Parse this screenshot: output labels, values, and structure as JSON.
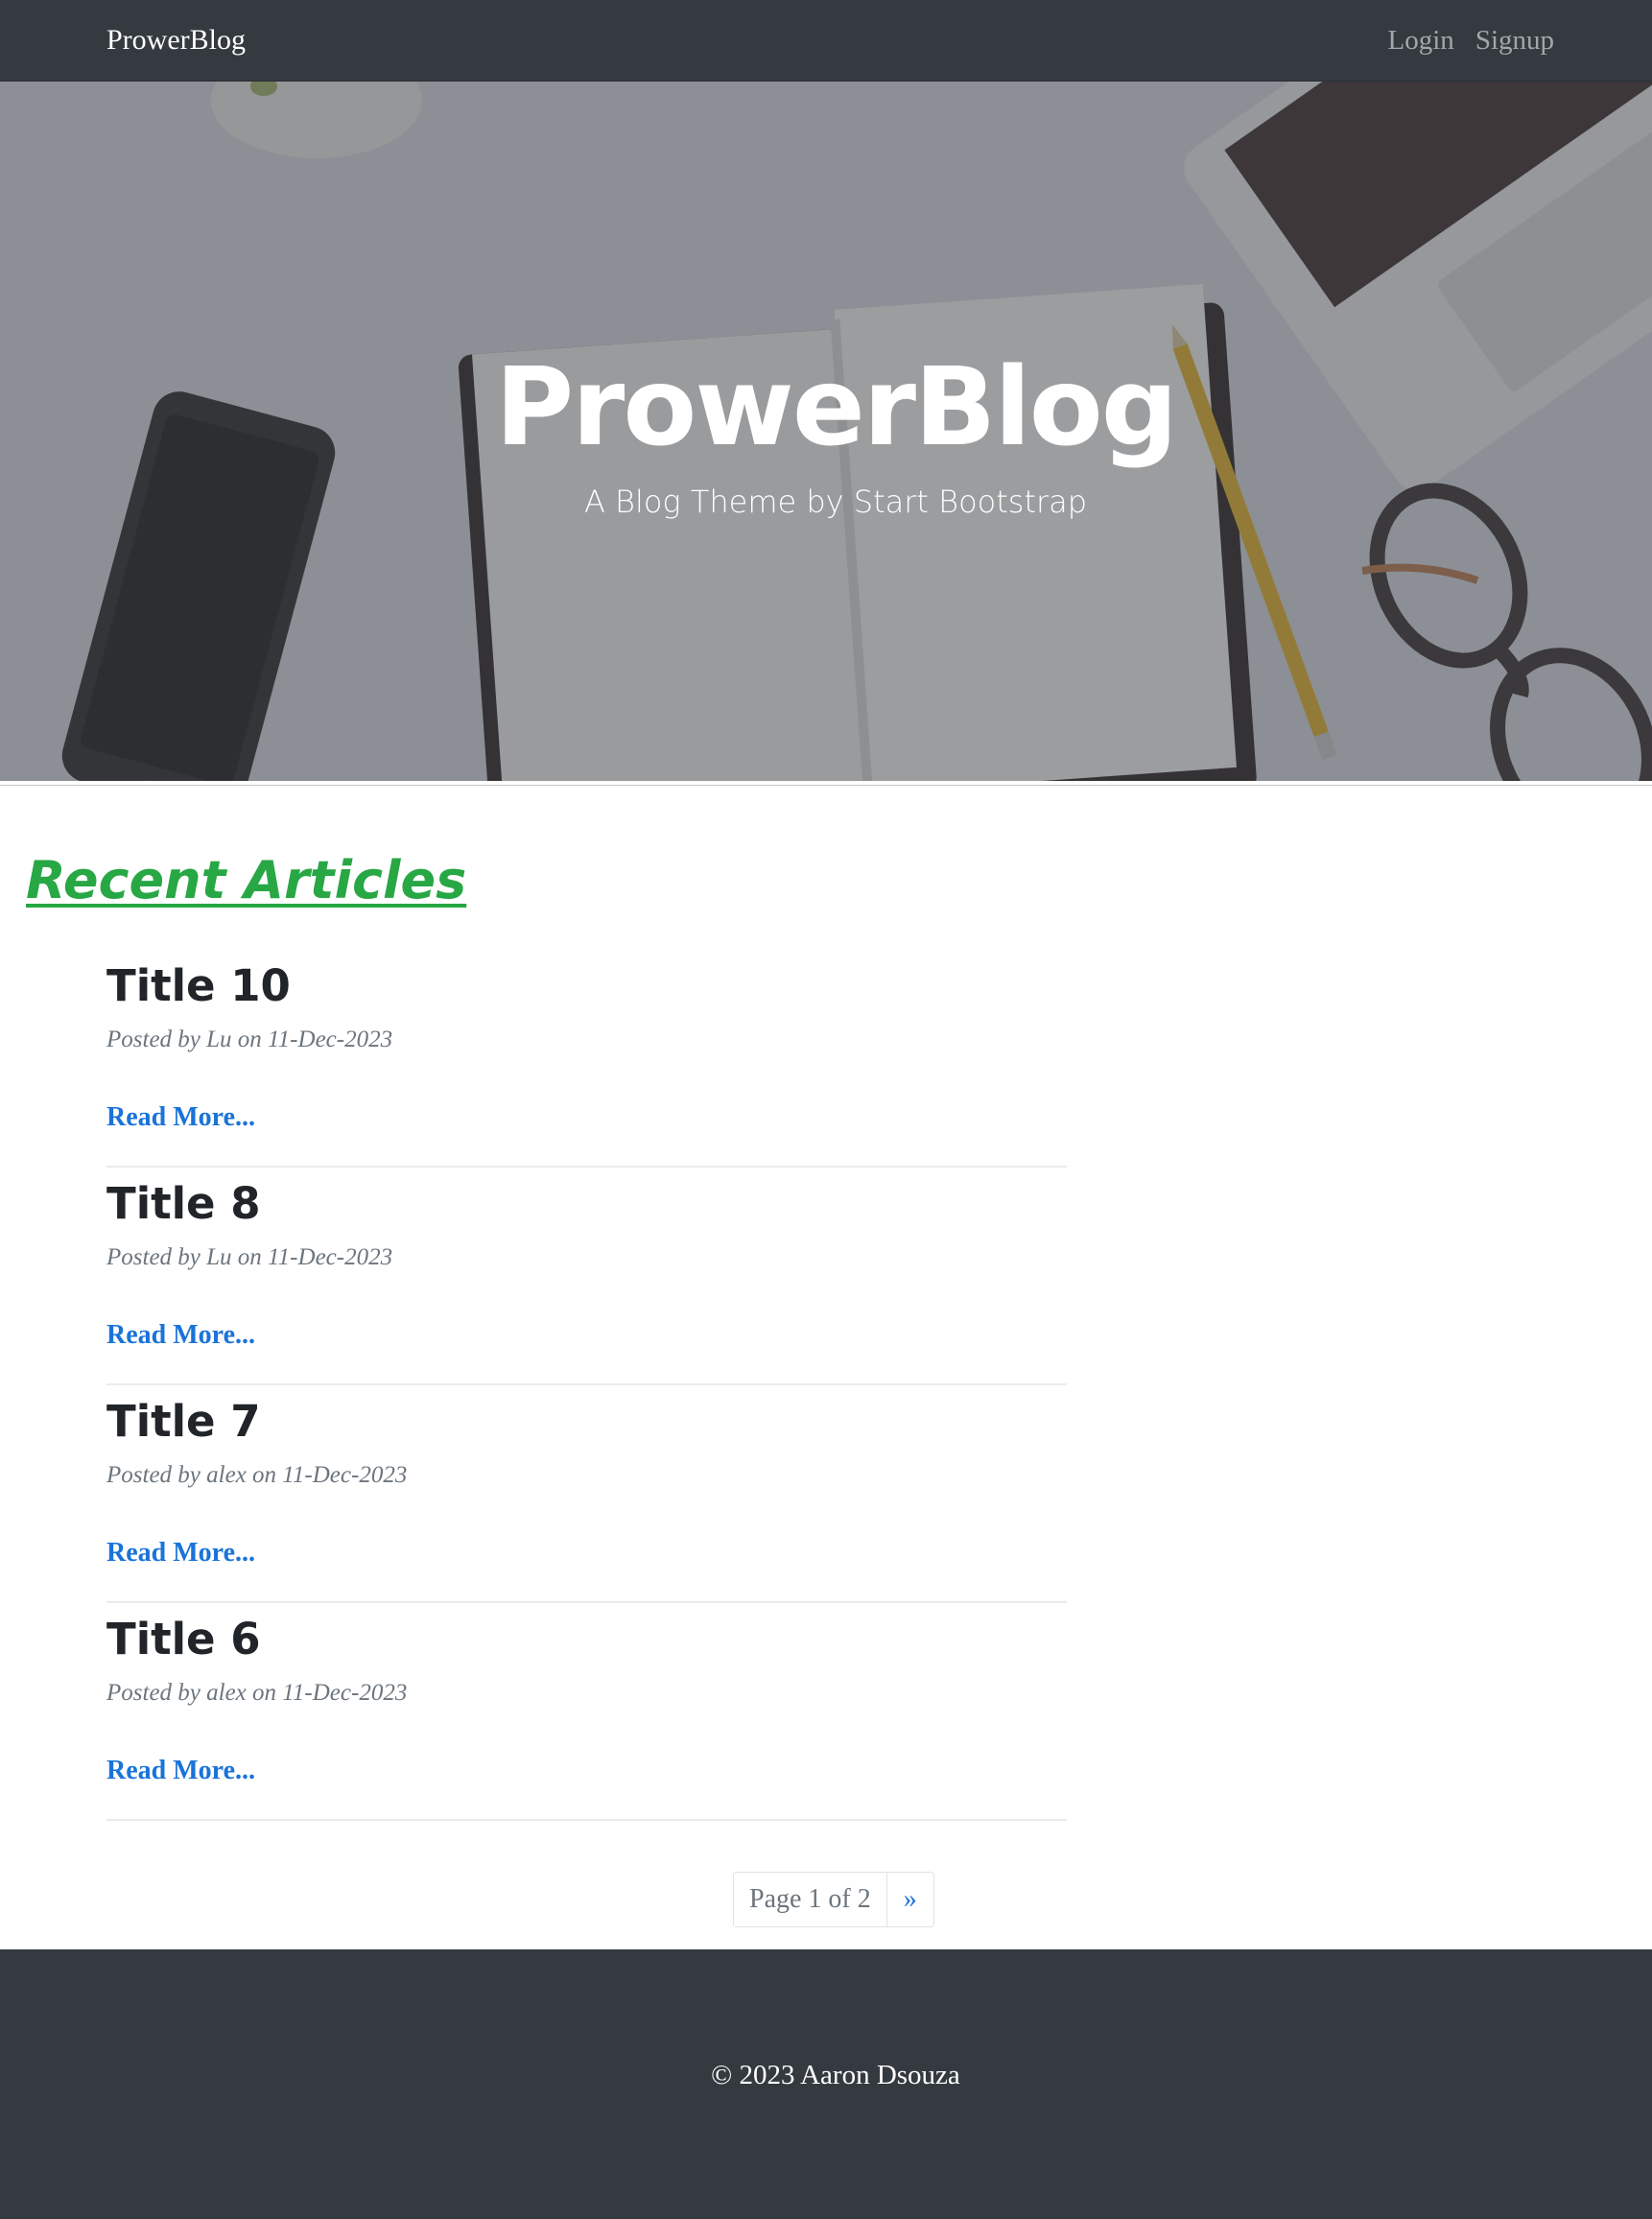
{
  "navbar": {
    "brand": "ProwerBlog",
    "links": {
      "login": "Login",
      "signup": "Signup"
    }
  },
  "hero": {
    "title": "ProwerBlog",
    "subtitle": "A Blog Theme by Start Bootstrap"
  },
  "section": {
    "heading": "Recent Articles"
  },
  "posts": [
    {
      "title": "Title 10",
      "meta": "Posted by Lu on 11-Dec-2023",
      "read_more": "Read More..."
    },
    {
      "title": "Title 8",
      "meta": "Posted by Lu on 11-Dec-2023",
      "read_more": "Read More..."
    },
    {
      "title": "Title 7",
      "meta": "Posted by alex on 11-Dec-2023",
      "read_more": "Read More..."
    },
    {
      "title": "Title 6",
      "meta": "Posted by alex on 11-Dec-2023",
      "read_more": "Read More..."
    }
  ],
  "pagination": {
    "status": "Page 1 of 2",
    "next": "»"
  },
  "footer": {
    "copyright": "© 2023 Aaron Dsouza"
  },
  "colors": {
    "navbar_bg": "#343a40",
    "heading_green": "#28a745",
    "link_blue": "#1a73d9",
    "muted": "#6c757d"
  }
}
